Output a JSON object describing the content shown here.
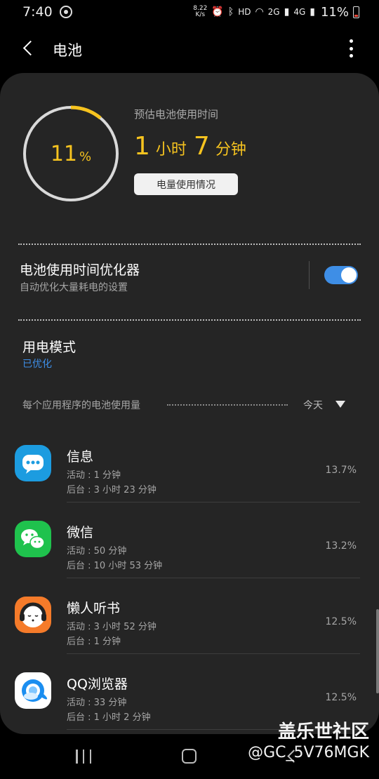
{
  "status_bar": {
    "time": "7:40",
    "speed_value": "8.22",
    "speed_unit": "K/s",
    "hd": "HD",
    "net_2g": "2G",
    "net_4g": "4G",
    "battery_pct": "11%"
  },
  "header": {
    "title": "电池"
  },
  "battery": {
    "level_fraction": 0.11,
    "pct_number": "11",
    "pct_sign": "%",
    "ring_color": "#f6c31f",
    "est_label": "预估电池使用时间",
    "est_hours": "1",
    "est_hours_unit": "小时",
    "est_minutes": "7",
    "est_minutes_unit": "分钟",
    "usage_button": "电量使用情况"
  },
  "optimizer": {
    "title": "电池使用时间优化器",
    "subtitle": "自动优化大量耗电的设置",
    "enabled": true
  },
  "power_mode": {
    "title": "用电模式",
    "value": "已优化"
  },
  "app_usage": {
    "section_label": "每个应用程序的电池使用量",
    "period": "今天",
    "apps": [
      {
        "name": "信息",
        "active": "活动 : 1 分钟",
        "background": "后台 : 3 小时 23 分钟",
        "percent": "13.7%",
        "icon": "messages-icon"
      },
      {
        "name": "微信",
        "active": "活动 : 50 分钟",
        "background": "后台 : 10 小时 53 分钟",
        "percent": "13.2%",
        "icon": "wechat-icon"
      },
      {
        "name": "懒人听书",
        "active": "活动 : 3 小时 52 分钟",
        "background": "后台 : 1 分钟",
        "percent": "12.5%",
        "icon": "lazy-audiobook-icon"
      },
      {
        "name": "QQ浏览器",
        "active": "活动 : 33 分钟",
        "background": "后台 : 1 小时 2 分钟",
        "percent": "12.5%",
        "icon": "qq-browser-icon"
      }
    ]
  },
  "watermark": {
    "line1": "盖乐世社区",
    "line2": "@GC_5V76MGK"
  }
}
